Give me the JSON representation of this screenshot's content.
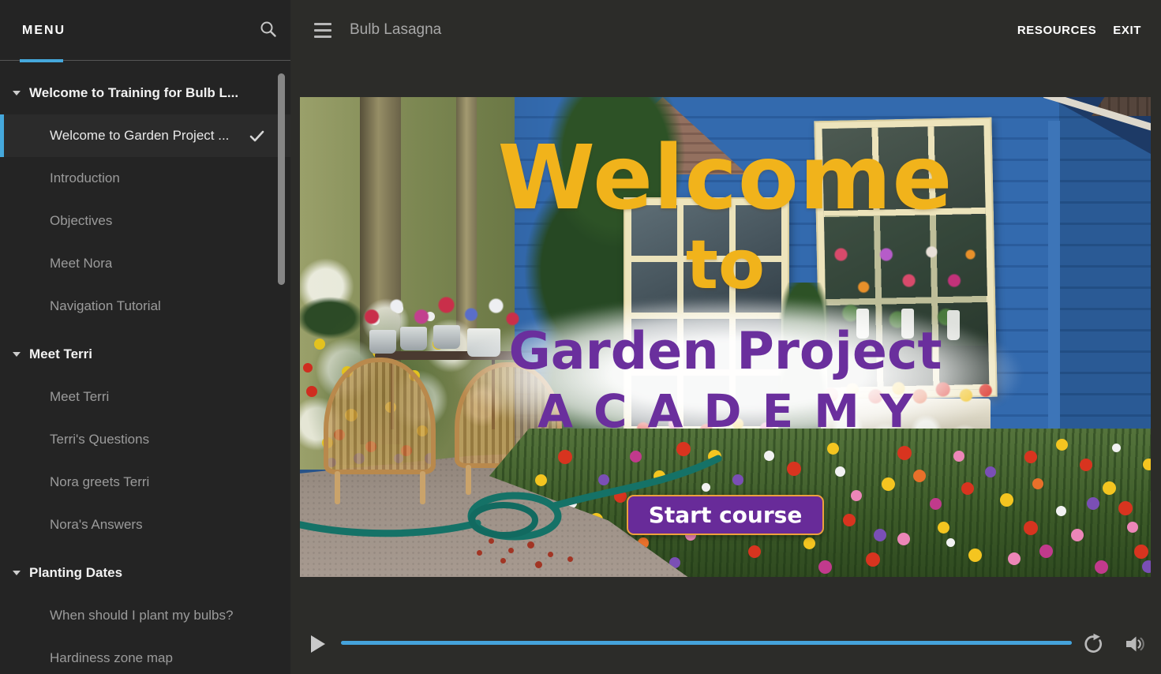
{
  "topbar": {
    "title": "Bulb Lasagna",
    "resources": "RESOURCES",
    "exit": "EXIT"
  },
  "sidebar": {
    "tab_label": "MENU",
    "sections": [
      {
        "title": "Welcome to Training for Bulb L...",
        "items": [
          "Welcome to Garden Project ...",
          "Introduction",
          "Objectives",
          "Meet Nora",
          "Navigation Tutorial"
        ]
      },
      {
        "title": "Meet Terri",
        "items": [
          "Meet Terri",
          "Terri's Questions",
          "Nora greets Terri",
          "Nora's Answers"
        ]
      },
      {
        "title": "Planting Dates",
        "items": [
          "When should I plant my bulbs?",
          "Hardiness zone map"
        ]
      }
    ],
    "active_item_label": "Welcome to Garden Project ...",
    "completed_item_label": "Welcome to Garden Project ..."
  },
  "slide": {
    "heading_line1": "Welcome",
    "heading_line2": "to",
    "subheading_line1": "Garden Project",
    "subheading_line2": "ACADEMY",
    "start_button": "Start course"
  },
  "player": {
    "progress_percent": 100
  },
  "icons": {
    "search": "magnifier",
    "menu_toggle": "hamburger",
    "section_collapse": "caret-down",
    "completed": "checkmark",
    "play": "play-triangle",
    "replay": "circular-arrow",
    "volume": "speaker"
  },
  "colors": {
    "accent_blue": "#45a8dc",
    "heading_yellow": "#f1b31b",
    "subheading_purple": "#6a2f9d",
    "button_purple": "#682b99",
    "button_border_orange": "#eda13e",
    "sidebar_bg": "#242424",
    "main_bg": "#2c2c29"
  }
}
